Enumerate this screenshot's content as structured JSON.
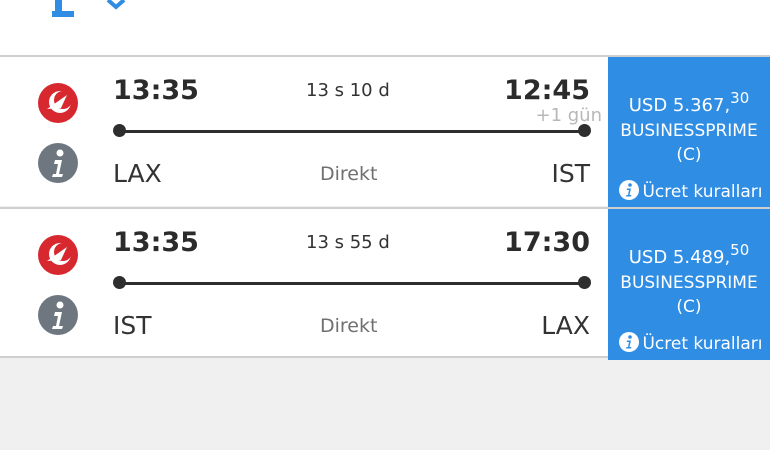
{
  "colors": {
    "accent_blue": "#2f8de4",
    "airline_red": "#d7282f",
    "text_dark": "#2b2b2b",
    "text_muted": "#707070",
    "text_faint": "#b8b8b8",
    "info_grey": "#6e7780",
    "background": "#f0f0f0"
  },
  "icons": {
    "top": "sort-icon",
    "airline": "turkish-airlines-logo",
    "info": "info-icon"
  },
  "flights": [
    {
      "departure_time": "13:35",
      "duration": "13 s 10 d",
      "arrival_time": "12:45",
      "day_offset": "+1 gün",
      "from": "LAX",
      "stops": "Direkt",
      "to": "IST",
      "fare": {
        "price": "USD 5.367,",
        "price_decimal": "30",
        "fare_class": "BUSINESSPRIME",
        "fare_code": "(C)",
        "rules_label": "Ücret kuralları"
      }
    },
    {
      "departure_time": "13:35",
      "duration": "13 s 55 d",
      "arrival_time": "17:30",
      "from": "IST",
      "stops": "Direkt",
      "to": "LAX",
      "fare": {
        "price": "USD 5.489,",
        "price_decimal": "50",
        "fare_class": "BUSINESSPRIME",
        "fare_code": "(C)",
        "rules_label": "Ücret kuralları"
      }
    }
  ]
}
